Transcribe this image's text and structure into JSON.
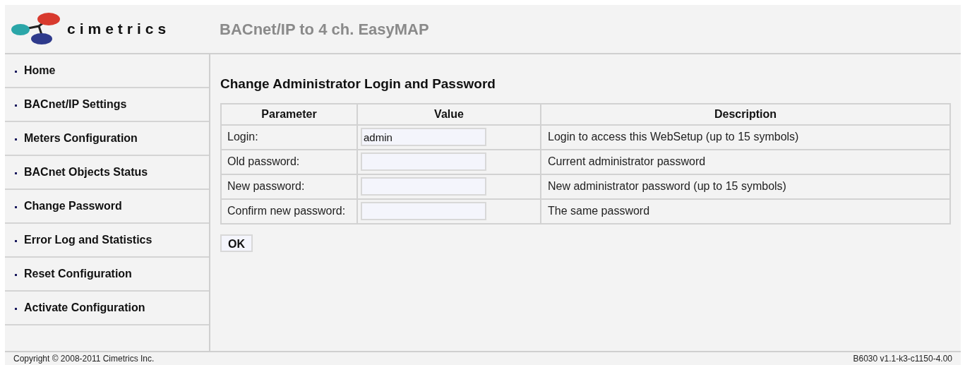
{
  "header": {
    "logo_text": "cimetrics",
    "title": "BACnet/IP to 4 ch. EasyMAP"
  },
  "sidebar": {
    "items": [
      {
        "label": "Home"
      },
      {
        "label": "BACnet/IP Settings"
      },
      {
        "label": "Meters Configuration"
      },
      {
        "label": "BACnet Objects Status"
      },
      {
        "label": "Change Password"
      },
      {
        "label": "Error Log and Statistics"
      },
      {
        "label": "Reset Configuration"
      },
      {
        "label": "Activate Configuration"
      }
    ]
  },
  "content": {
    "heading": "Change Administrator Login and Password",
    "table": {
      "columns": [
        "Parameter",
        "Value",
        "Description"
      ],
      "rows": [
        {
          "parameter": "Login:",
          "value": "admin",
          "description": "Login to access this WebSetup (up to 15 symbols)"
        },
        {
          "parameter": "Old password:",
          "value": "",
          "description": "Current administrator password"
        },
        {
          "parameter": "New password:",
          "value": "",
          "description": "New administrator password (up to 15 symbols)"
        },
        {
          "parameter": "Confirm new password:",
          "value": "",
          "description": "The same password"
        }
      ]
    },
    "ok_button": "OK"
  },
  "footer": {
    "copyright": "Copyright © 2008-2011 Cimetrics Inc.",
    "version": "B6030 v1.1-k3-c1150-4.00"
  }
}
